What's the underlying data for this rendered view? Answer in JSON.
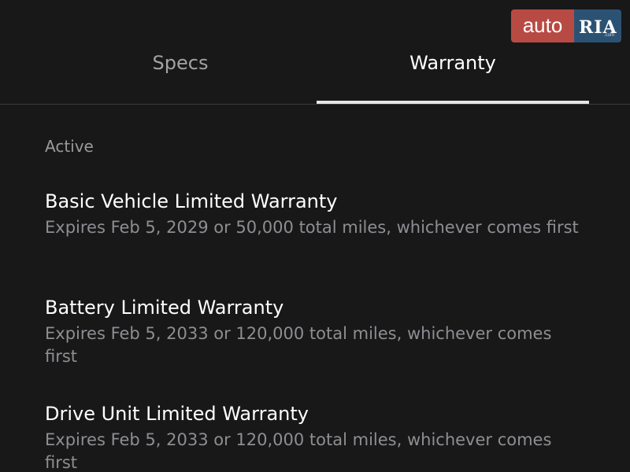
{
  "logo": {
    "auto": "auto",
    "ria": "RIA",
    "com": ".com"
  },
  "tabs": [
    {
      "label": "Specs",
      "active": false
    },
    {
      "label": "Warranty",
      "active": true
    }
  ],
  "section": {
    "label": "Active"
  },
  "warranties": [
    {
      "title": "Basic Vehicle Limited Warranty",
      "description": "Expires Feb 5, 2029 or 50,000 total miles, whichever comes first"
    },
    {
      "title": "Battery Limited Warranty",
      "description": "Expires Feb 5, 2033 or 120,000 total miles, whichever comes first"
    },
    {
      "title": "Drive Unit Limited Warranty",
      "description": "Expires Feb 5, 2033 or 120,000 total miles, whichever comes first"
    }
  ],
  "colors": {
    "background": "#181819",
    "active_tab": "#ffffff",
    "inactive_tab": "#a3a3a6",
    "description": "#8e8e92",
    "logo_auto": "#b84a44",
    "logo_ria": "#2b5272"
  }
}
